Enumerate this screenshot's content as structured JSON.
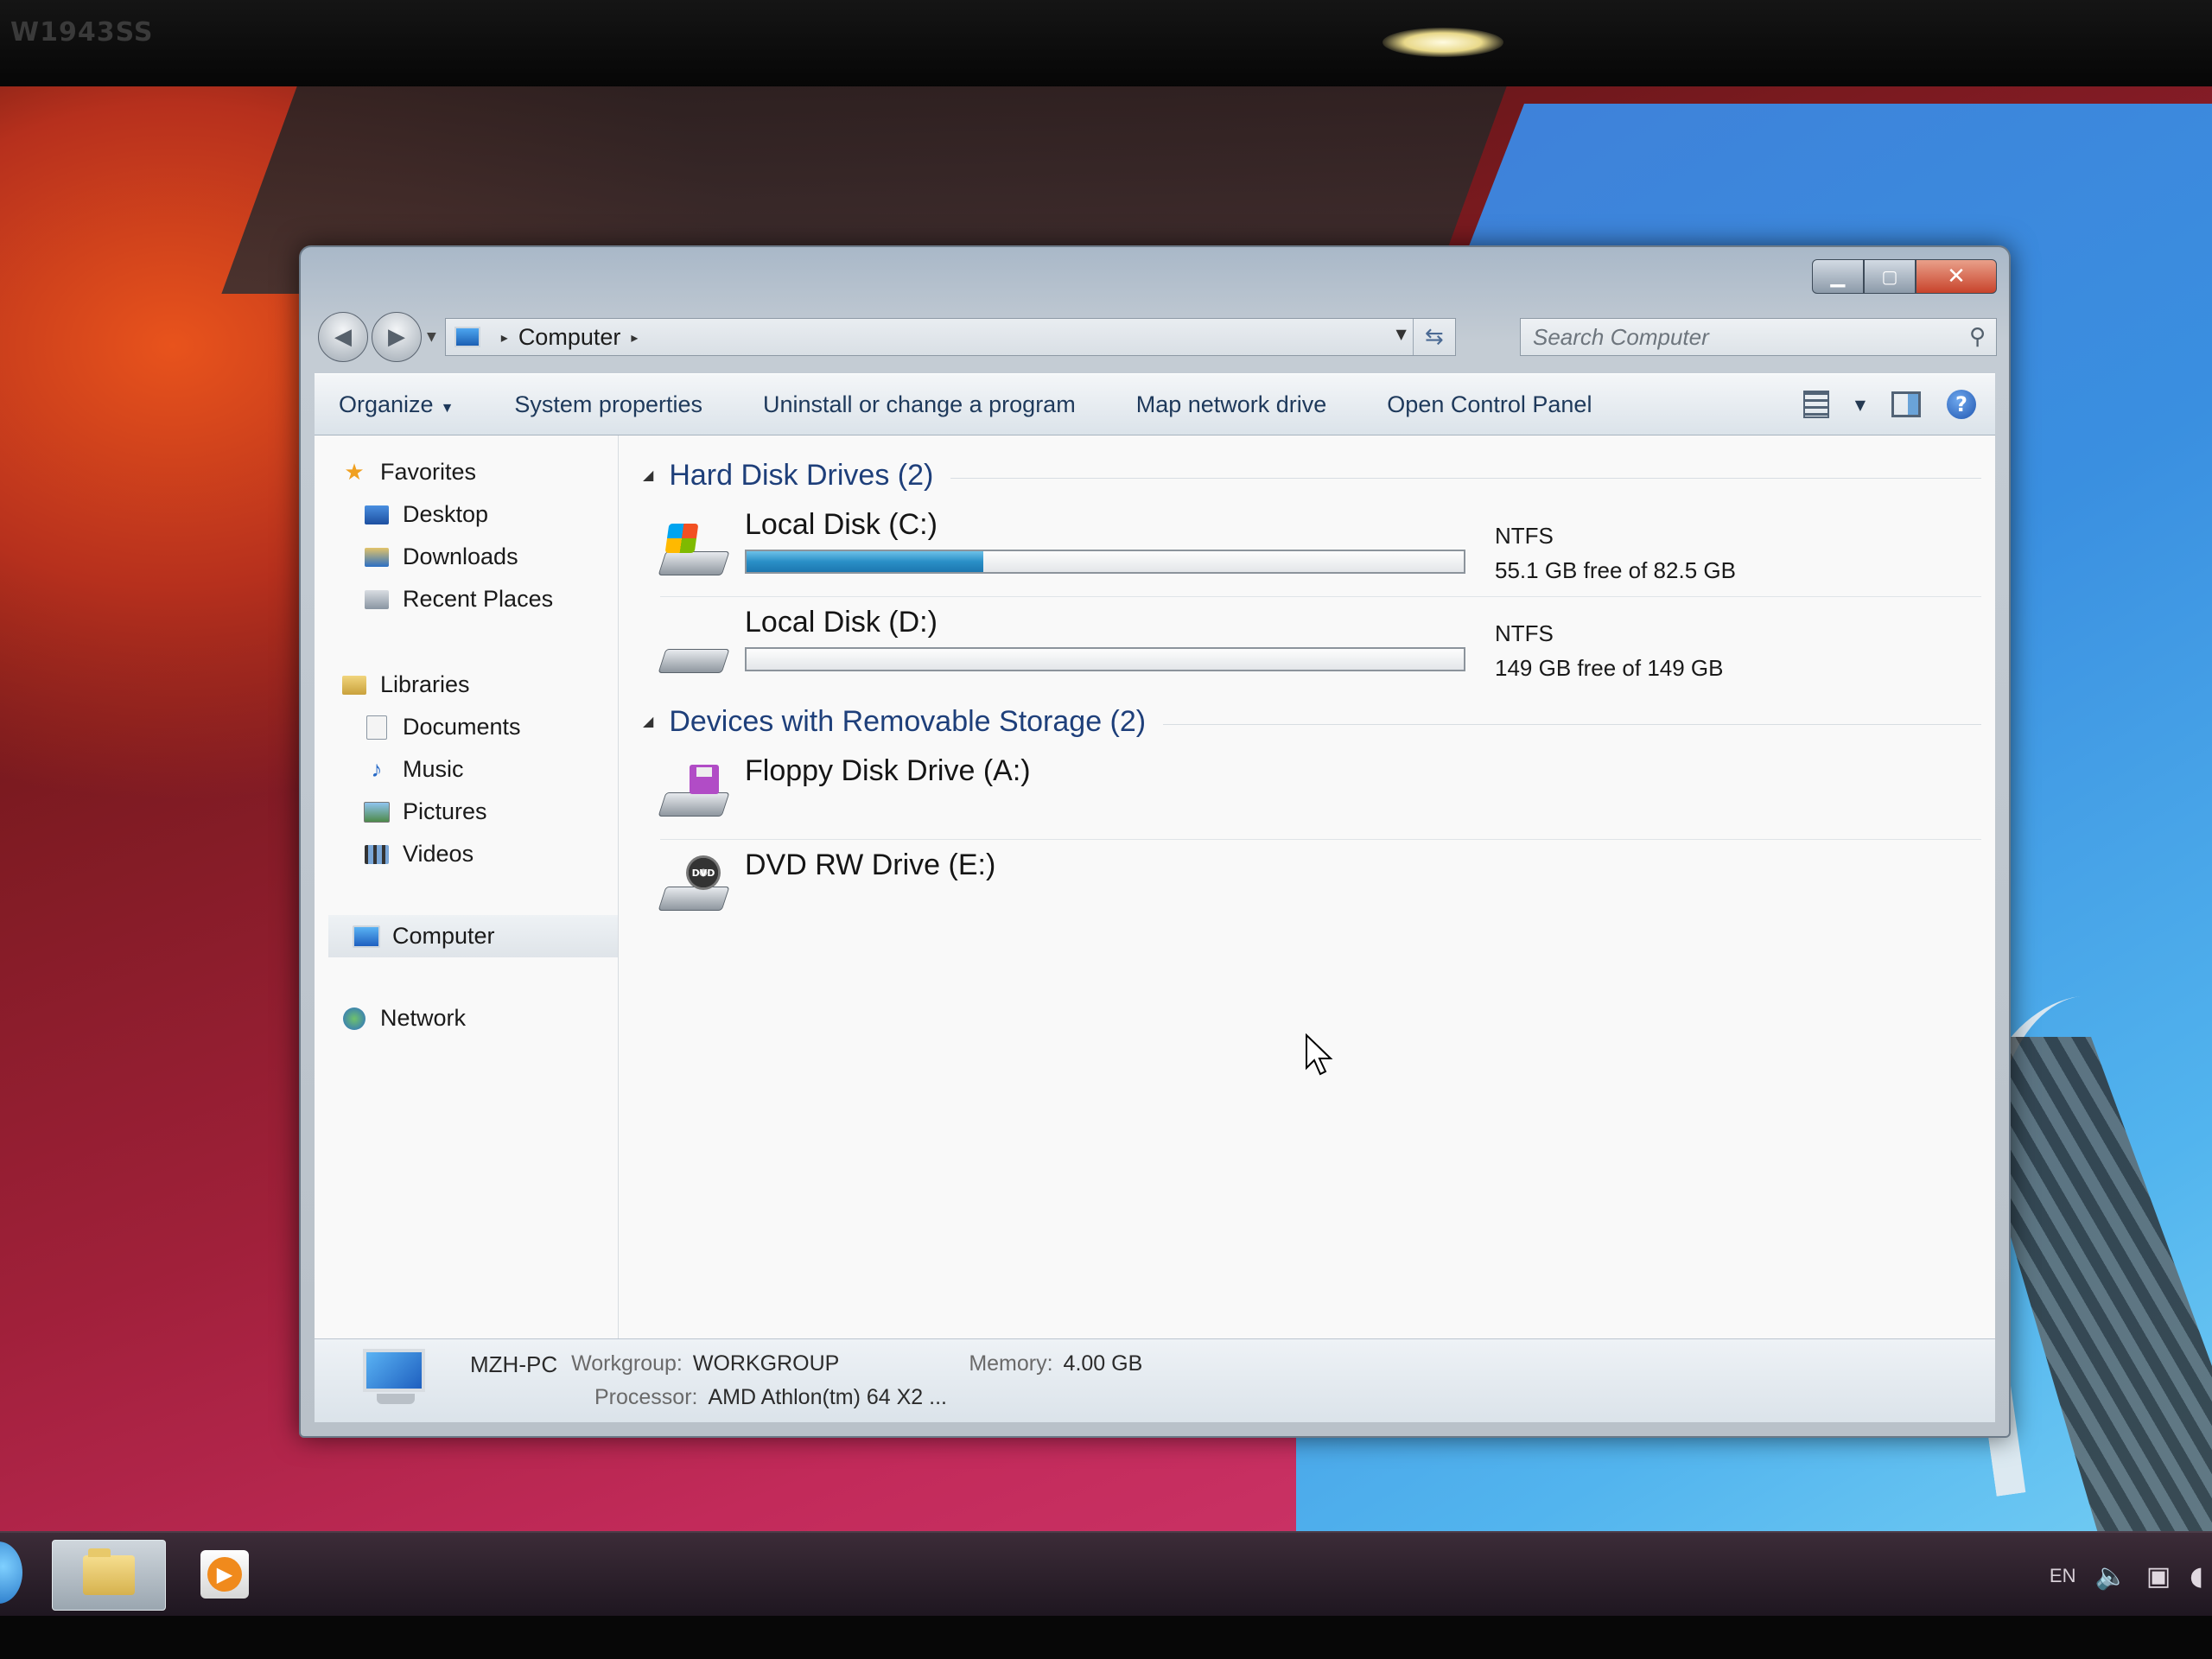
{
  "monitor": {
    "label": "W1943SS"
  },
  "window": {
    "address": {
      "location": "Computer"
    },
    "search": {
      "placeholder": "Search Computer"
    },
    "command_bar": {
      "organize": "Organize",
      "system_properties": "System properties",
      "uninstall": "Uninstall or change a program",
      "map_drive": "Map network drive",
      "control_panel": "Open Control Panel"
    },
    "nav": {
      "favorites": "Favorites",
      "desktop": "Desktop",
      "downloads": "Downloads",
      "recent": "Recent Places",
      "libraries": "Libraries",
      "documents": "Documents",
      "music": "Music",
      "pictures": "Pictures",
      "videos": "Videos",
      "computer": "Computer",
      "network": "Network"
    },
    "groups": {
      "hdd": "Hard Disk Drives (2)",
      "removable": "Devices with Removable Storage (2)"
    },
    "drives": [
      {
        "name": "Local Disk (C:)",
        "fs": "NTFS",
        "space": "55.1 GB free of 82.5 GB",
        "used_fraction": 0.33,
        "icon": "windows-drive-icon"
      },
      {
        "name": "Local Disk (D:)",
        "fs": "NTFS",
        "space": "149 GB free of 149 GB",
        "used_fraction": 0.0,
        "icon": "hard-drive-icon"
      }
    ],
    "removable": [
      {
        "name": "Floppy Disk Drive (A:)",
        "icon": "floppy-drive-icon"
      },
      {
        "name": "DVD RW Drive (E:)",
        "icon": "dvd-drive-icon",
        "badge": "DVD"
      }
    ],
    "details": {
      "computer_name": "MZH-PC",
      "workgroup_label": "Workgroup:",
      "workgroup_value": "WORKGROUP",
      "memory_label": "Memory:",
      "memory_value": "4.00 GB",
      "processor_label": "Processor:",
      "processor_value": "AMD Athlon(tm) 64 X2 ..."
    }
  },
  "taskbar": {
    "language": "EN"
  },
  "colors": {
    "accent_text": "#1e3f7a",
    "progress": "#2a8fc7"
  }
}
